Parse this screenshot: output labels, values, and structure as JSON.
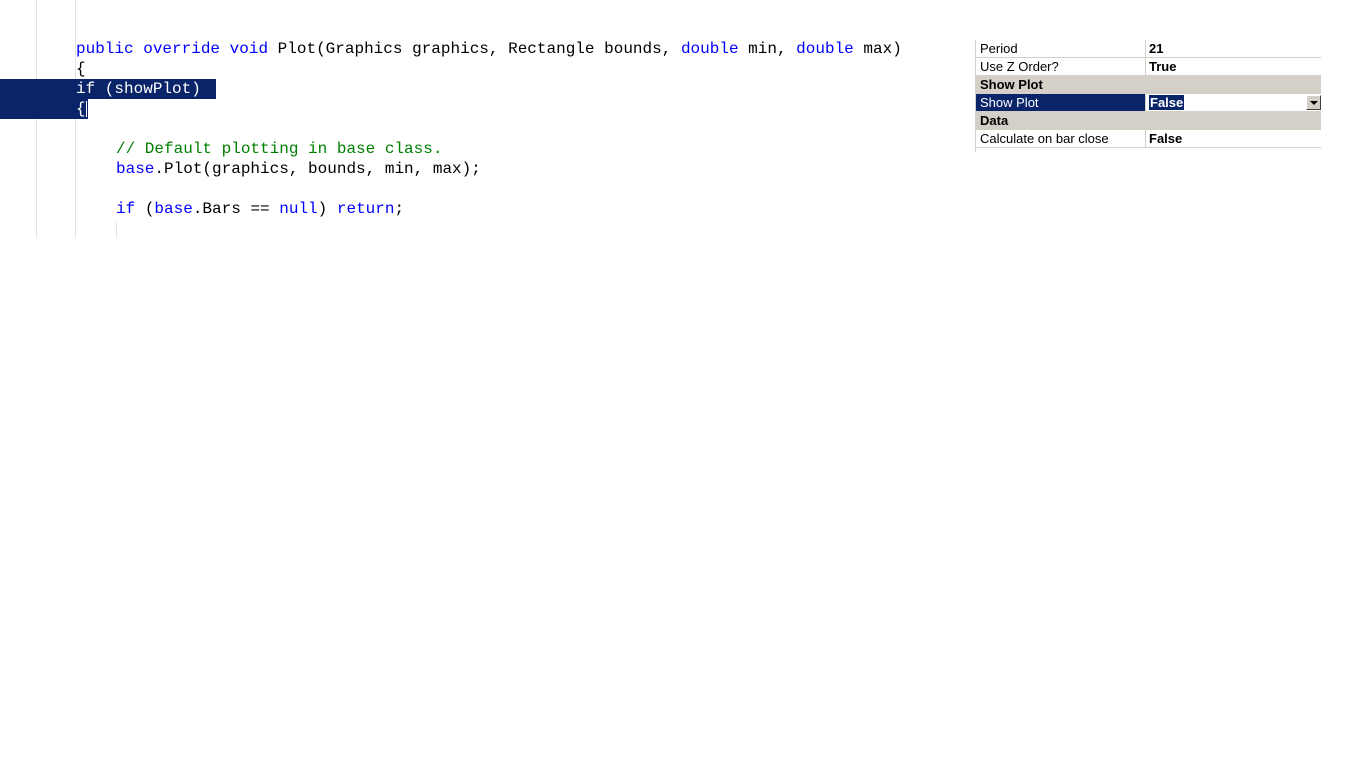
{
  "code_editor": {
    "lines": {
      "signature": {
        "kw_public": "public",
        "kw_override": "override",
        "kw_void": "void",
        "text_1": "Plot(Graphics graphics, Rectangle bounds,",
        "kw_double_1": "double",
        "text_2": "min,",
        "kw_double_2": "double",
        "text_3": "max)"
      },
      "open_brace": "{",
      "if_show_plot": "if (showPlot)",
      "inner_brace": "{",
      "comment": "// Default plotting in base class.",
      "base_plot": {
        "kw_base": "base",
        "text": ".Plot(graphics, bounds, min, max);"
      },
      "bars_check": {
        "kw_if": "if",
        "text_1": "(",
        "kw_base": "base",
        "text_2": ".Bars ==",
        "kw_null": "null",
        "text_3": ")",
        "kw_return": "return",
        "text_4": ";"
      }
    },
    "colors": {
      "keyword": "#0000ff",
      "comment": "#008000",
      "selection": "#0a246a"
    }
  },
  "property_grid": {
    "rows": [
      {
        "name": "Period",
        "value": "21"
      },
      {
        "name": "Use Z Order?",
        "value": "True"
      }
    ],
    "category_show_plot": "Show Plot",
    "selected_row": {
      "name": "Show Plot",
      "value": "False"
    },
    "category_data": "Data",
    "data_rows": [
      {
        "name": "Calculate on bar close",
        "value": "False"
      }
    ],
    "dropdown_icon": "chevron-down-icon"
  }
}
